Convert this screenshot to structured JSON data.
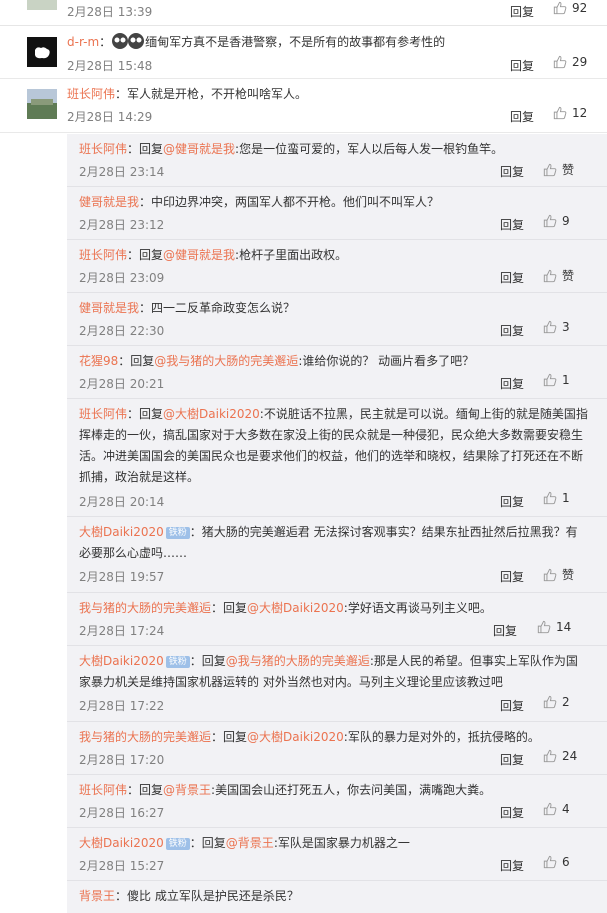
{
  "top": {
    "time": "2月28日 13:39",
    "reply": "回复",
    "likes": "92"
  },
  "comments": [
    {
      "name": "d-r-m",
      "sep": "：",
      "text": "缅甸军方真不是香港警察，不是所有的故事都有参考性的",
      "time": "2月28日 15:48",
      "reply": "回复",
      "likes": "29"
    },
    {
      "name": "班长阿伟",
      "sep": "：",
      "text": "军人就是开枪，不开枪叫啥军人。",
      "time": "2月28日 14:29",
      "reply": "回复",
      "likes": "12"
    }
  ],
  "replies": [
    {
      "name": "班长阿伟",
      "prefix": "：回复",
      "mention": "@健哥就是我",
      "text": ":您是一位蛮可爱的，军人以后每人发一根钓鱼竿。",
      "time": "2月28日 23:14",
      "reply": "回复",
      "likes": "赞"
    },
    {
      "name": "健哥就是我",
      "prefix": "：",
      "mention": "",
      "text": "中印边界冲突，两国军人都不开枪。他们叫不叫军人？",
      "time": "2月28日 23:12",
      "reply": "回复",
      "likes": "9"
    },
    {
      "name": "班长阿伟",
      "prefix": "：回复",
      "mention": "@健哥就是我",
      "text": ":枪杆子里面出政权。",
      "time": "2月28日 23:09",
      "reply": "回复",
      "likes": "赞"
    },
    {
      "name": "健哥就是我",
      "prefix": "：",
      "mention": "",
      "text": "四一二反革命政变怎么说？",
      "time": "2月28日 22:30",
      "reply": "回复",
      "likes": "3"
    },
    {
      "name": "花猩98",
      "prefix": "：回复",
      "mention": "@我与猪的大肠的完美邂逅",
      "text": ":谁给你说的？ 动画片看多了吧？",
      "time": "2月28日 20:21",
      "reply": "回复",
      "likes": "1"
    },
    {
      "name": "班长阿伟",
      "prefix": "：回复",
      "mention": "@大樹Daiki2020",
      "text": ":不说脏话不拉黑，民主就是可以说。缅甸上街的就是随美国指挥棒走的一伙，搞乱国家对于大多数在家没上街的民众就是一种侵犯，民众绝大多数需要安稳生活。冲进美国国会的美国民众也是要求他们的权益，他们的选举和晓权，结果除了打死还在不断抓捕，政治就是这样。",
      "time": "2月28日 20:14",
      "reply": "回复",
      "likes": "1"
    },
    {
      "name": "大樹Daiki2020",
      "badge": "铁粉",
      "prefix": "：",
      "mention": "",
      "text": "猪大肠的完美邂逅君 无法探讨客观事实？结果东扯西扯然后拉黑我？有必要那么心虚吗……",
      "time": "2月28日 19:57",
      "reply": "回复",
      "likes": "赞"
    },
    {
      "name": "我与猪的大肠的完美邂逅",
      "prefix": "：回复",
      "mention": "@大樹Daiki2020",
      "text": ":学好语文再谈马列主义吧。",
      "time": "2月28日 17:24",
      "reply": "回复",
      "likes": "14"
    },
    {
      "name": "大樹Daiki2020",
      "badge": "铁粉",
      "prefix": "：回复",
      "mention": "@我与猪的大肠的完美邂逅",
      "text": ":那是人民的希望。但事实上军队作为国家暴力机关是维持国家机器运转的 对外当然也对内。马列主义理论里应该教过吧",
      "time": "2月28日 17:22",
      "reply": "回复",
      "likes": "2"
    },
    {
      "name": "我与猪的大肠的完美邂逅",
      "prefix": "：回复",
      "mention": "@大樹Daiki2020",
      "text": ":军队的暴力是对外的，抵抗侵略的。",
      "time": "2月28日 17:20",
      "reply": "回复",
      "likes": "24"
    },
    {
      "name": "班长阿伟",
      "prefix": "：回复",
      "mention": "@背景王",
      "text": ":美国国会山还打死五人，你去问美国，满嘴跑大粪。",
      "time": "2月28日 16:27",
      "reply": "回复",
      "likes": "4"
    },
    {
      "name": "大樹Daiki2020",
      "badge": "铁粉",
      "prefix": "：回复",
      "mention": "@背景王",
      "text": ":军队是国家暴力机器之一",
      "time": "2月28日 15:27",
      "reply": "回复",
      "likes": "6"
    },
    {
      "name": "背景王",
      "prefix": "：",
      "mention": "",
      "text": "傻比 成立军队是护民还是杀民？",
      "time": "",
      "reply": "",
      "likes": ""
    }
  ]
}
